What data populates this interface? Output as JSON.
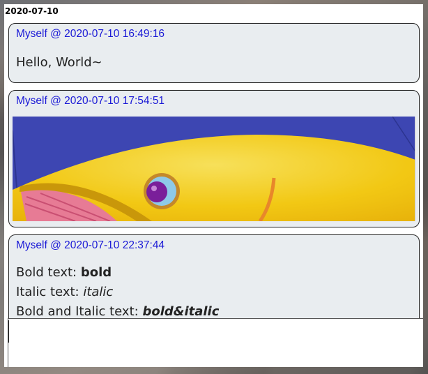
{
  "feed": {
    "date_heading": "2020-07-10",
    "messages": [
      {
        "meta": "Myself @ 2020-07-10 16:49:16",
        "text": "Hello, World~"
      },
      {
        "meta": "Myself @ 2020-07-10 17:54:51",
        "image_alt": "fish-illustration"
      },
      {
        "meta": "Myself @ 2020-07-10 22:37:44",
        "lines": [
          {
            "prefix": "Bold text: ",
            "emph": "bold"
          },
          {
            "prefix": "Italic text: ",
            "emph": "italic"
          },
          {
            "prefix": "Bold and Italic text: ",
            "emph": "bold&italic"
          }
        ]
      }
    ]
  },
  "composer": {
    "value": ""
  },
  "colors": {
    "meta_link": "#1a19d6",
    "bubble_bg": "#e9edf0",
    "image_bg": "#3d46b2",
    "fish_body": "#f2c814"
  }
}
